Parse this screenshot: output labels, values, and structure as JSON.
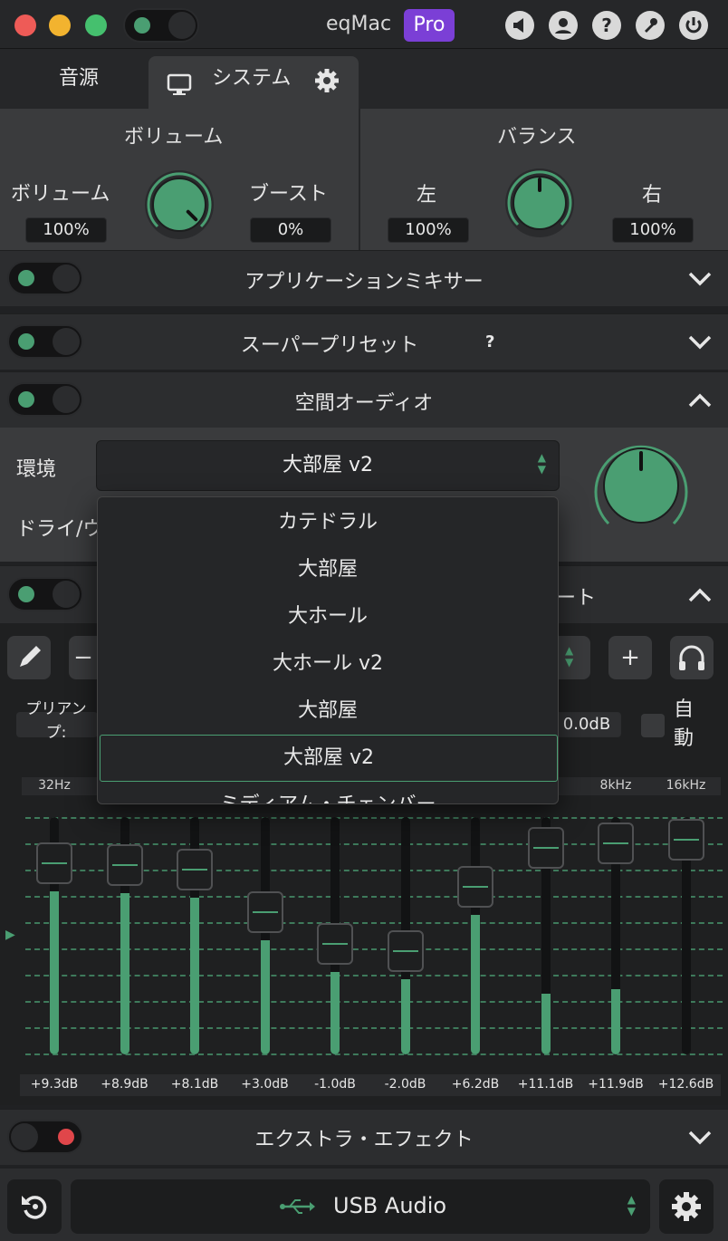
{
  "app": {
    "title": "eqMac",
    "badge": "Pro"
  },
  "tabs": {
    "source": "音源",
    "system": "システム"
  },
  "volume": {
    "title": "ボリューム",
    "volume_label": "ボリューム",
    "volume_value": "100%",
    "boost_label": "ブースト",
    "boost_value": "0%"
  },
  "balance": {
    "title": "バランス",
    "left_label": "左",
    "left_value": "100%",
    "right_label": "右",
    "right_value": "100%"
  },
  "sections": {
    "app_mixer": "アプリケーションミキサー",
    "super_preset": "スーパープリセット",
    "super_preset_help": "?",
    "spatial_audio": "空間オーディオ",
    "extra_effects": "エクストラ・エフェクト"
  },
  "spatial": {
    "environment_label": "環境",
    "environment_value": "大部屋 v2",
    "dry_wet_label": "ドライ/ウ",
    "options": [
      "カテドラル",
      "大部屋",
      "大ホール",
      "大ホール v2",
      "大部屋",
      "大部屋 v2",
      "ミディアム・チェンバー"
    ],
    "selected_index": 5
  },
  "equalizer": {
    "header_partial": "ート",
    "preamp_label": "プリアンプ:",
    "preamp_value": "0.0dB",
    "auto_label": "自動",
    "bands": [
      {
        "freq": "32Hz",
        "gain": "+9.3dB",
        "level": 0.87
      },
      {
        "freq": "",
        "gain": "+8.9dB",
        "level": 0.86
      },
      {
        "freq": "",
        "gain": "+8.1dB",
        "level": 0.84
      },
      {
        "freq": "",
        "gain": "+3.0dB",
        "level": 0.62
      },
      {
        "freq": "",
        "gain": "-1.0dB",
        "level": 0.46
      },
      {
        "freq": "",
        "gain": "-2.0dB",
        "level": 0.42
      },
      {
        "freq": "z",
        "gain": "+6.2dB",
        "level": 0.75
      },
      {
        "freq": "",
        "gain": "+11.1dB",
        "level": 0.95
      },
      {
        "freq": "8kHz",
        "gain": "+11.9dB",
        "level": 0.97
      },
      {
        "freq": "16kHz",
        "gain": "+12.6dB",
        "level": 0.99
      }
    ]
  },
  "footer": {
    "device": "USB Audio"
  },
  "colors": {
    "accent": "#4a9e72",
    "red": "#e0464a",
    "pro": "#7b3fd6"
  }
}
